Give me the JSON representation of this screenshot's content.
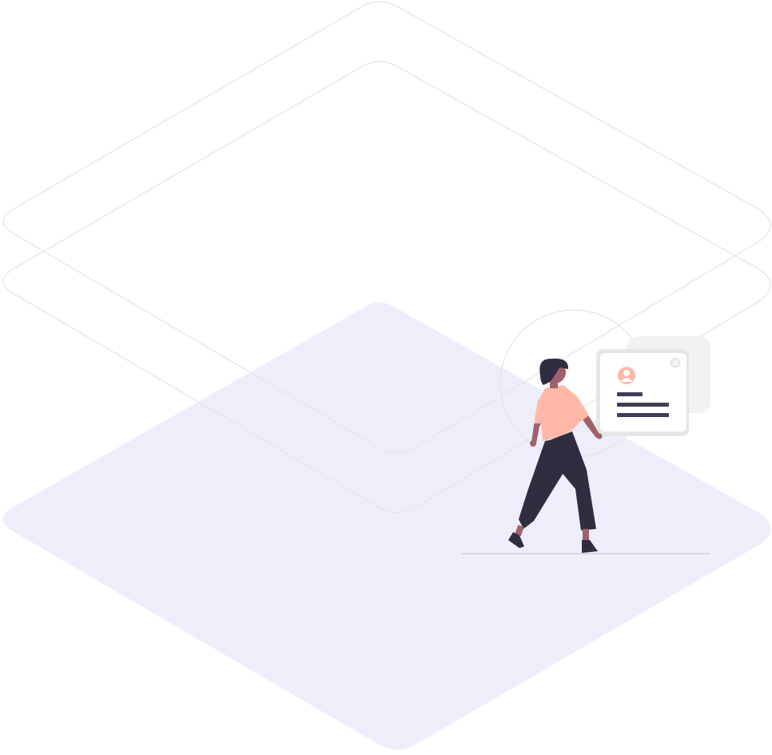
{
  "illustration": {
    "colors": {
      "background": "#ffffff",
      "floor_fill": "#eeeefb",
      "outline_stroke": "#e4e4e4",
      "card_back": "#f2f2f2",
      "card_face": "#ffffff",
      "card_border": "#e6e6e6",
      "accent": "#ffb8a8",
      "dark": "#3f3d56",
      "pants": "#2f2e41",
      "skin": "#a0616a",
      "hair": "#2f2e41",
      "ground_line": "#cccccc"
    },
    "icons": {
      "avatar": "user-avatar-icon",
      "close": "close-icon"
    }
  }
}
